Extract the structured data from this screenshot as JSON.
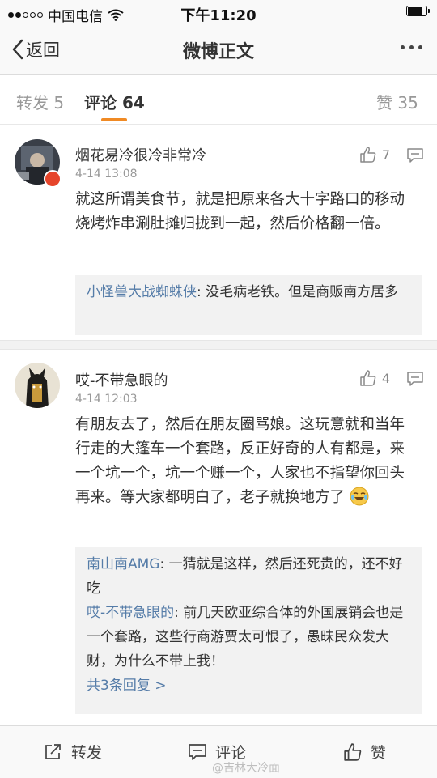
{
  "status": {
    "carrier": "中国电信",
    "time": "下午11:20",
    "battery_level": 0.85
  },
  "nav": {
    "back_label": "返回",
    "title": "微博正文"
  },
  "tabs": {
    "repost": "转发 5",
    "comments": "评论 64",
    "likes": "赞 35"
  },
  "comments": [
    {
      "user": "烟花易冷很冷非常冷",
      "time": "4-14 13:08",
      "likes": "7",
      "text": "就这所谓美食节，就是把原来各大十字路口的移动烧烤炸串涮肚摊归拢到一起，然后价格翻一倍。",
      "replies": [
        {
          "user": "小怪兽大战蜘蛛侠",
          "sep": ": ",
          "text": "没毛病老铁。但是商贩南方居多"
        }
      ]
    },
    {
      "user": "哎-不带急眼的",
      "time": "4-14 12:03",
      "likes": "4",
      "text": "有朋友去了，然后在朋友圈骂娘。这玩意就和当年行走的大篷车一个套路，反正好奇的人有都是，来一个坑一个，坑一个赚一个，人家也不指望你回头再来。等大家都明白了，老子就换地方了",
      "replies": [
        {
          "user": "南山南AMG",
          "sep": ": ",
          "text": "一猜就是这样，然后还死贵的，还不好吃"
        },
        {
          "user": "哎-不带急眼的",
          "sep": ": ",
          "text": "前几天欧亚综合体的外国展销会也是一个套路，这些行商游贾太可恨了，愚昧民众发大财，为什么不带上我！"
        }
      ],
      "more_replies": "共3条回复 >"
    }
  ],
  "bottom_bar": {
    "repost": "转发",
    "comment": "评论",
    "like": "赞"
  },
  "watermark": "@吉林大冷面",
  "colors": {
    "accent": "#f08a24",
    "link": "#557ca8"
  }
}
